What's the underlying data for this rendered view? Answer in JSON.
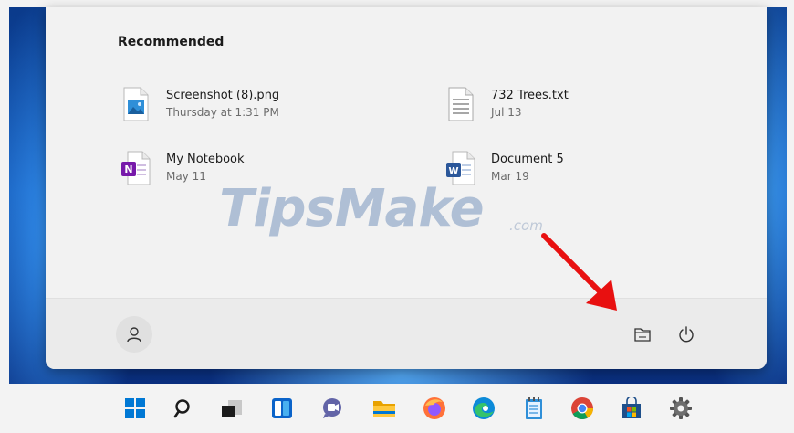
{
  "recommended": {
    "title": "Recommended",
    "items": [
      {
        "name": "Screenshot (8).png",
        "sub": "Thursday at 1:31 PM",
        "icon": "image-file-icon"
      },
      {
        "name": "732 Trees.txt",
        "sub": "Jul 13",
        "icon": "text-file-icon"
      },
      {
        "name": "My Notebook",
        "sub": "May 11",
        "icon": "onenote-file-icon"
      },
      {
        "name": "Document 5",
        "sub": "Mar 19",
        "icon": "word-file-icon"
      }
    ]
  },
  "watermark": {
    "text": "TipsMake",
    "suffix": ".com"
  },
  "footer": {
    "user_icon": "user-icon",
    "explorer_icon": "file-explorer-icon",
    "power_icon": "power-icon"
  },
  "taskbar": {
    "icons": [
      "windows-start-icon",
      "search-icon",
      "task-view-icon",
      "widgets-icon",
      "teams-chat-icon",
      "file-explorer-icon",
      "firefox-icon",
      "edge-icon",
      "notepad-icon",
      "chrome-icon",
      "microsoft-store-icon",
      "settings-icon"
    ]
  },
  "colors": {
    "accent": "#0067c0",
    "arrow": "#e81010",
    "onenote": "#7719aa",
    "word": "#2b579a"
  }
}
